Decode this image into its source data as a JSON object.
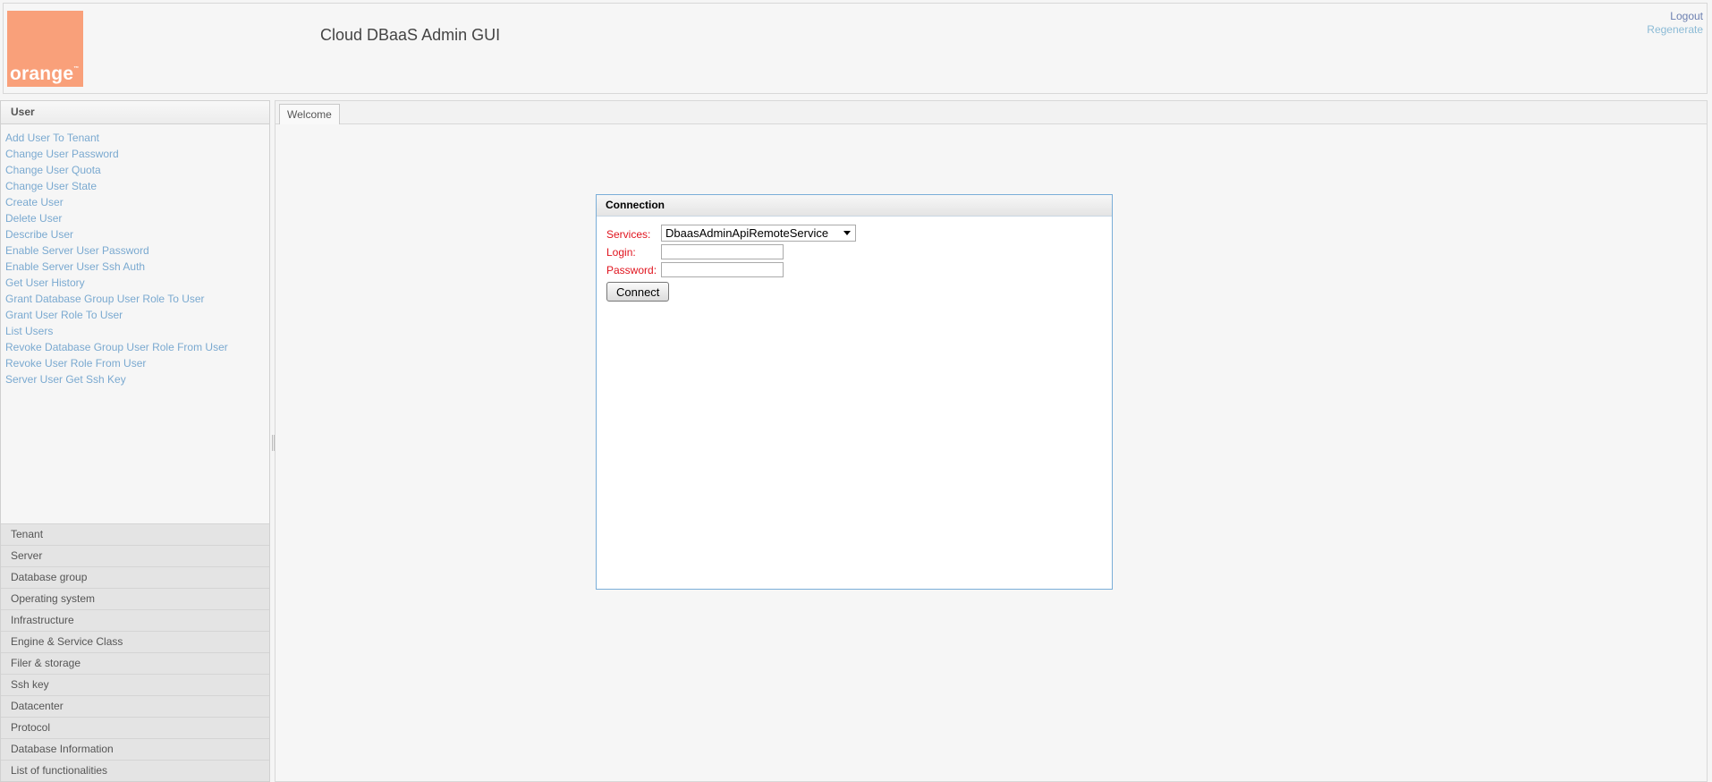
{
  "header": {
    "logo_text": "orange",
    "title": "Cloud DBaaS Admin GUI",
    "logout": "Logout",
    "regenerate": "Regenerate"
  },
  "left_panel": {
    "active_section": "User",
    "actions": [
      "Add User To Tenant",
      "Change User Password",
      "Change User Quota",
      "Change User State",
      "Create User",
      "Delete User",
      "Describe User",
      "Enable Server User Password",
      "Enable Server User Ssh Auth",
      "Get User History",
      "Grant Database Group User Role To User",
      "Grant User Role To User",
      "List Users",
      "Revoke Database Group User Role From User",
      "Revoke User Role From User",
      "Server User Get Ssh Key"
    ],
    "sections": [
      "Tenant",
      "Server",
      "Database group",
      "Operating system",
      "Infrastructure",
      "Engine & Service Class",
      "Filer & storage",
      "Ssh key",
      "Datacenter",
      "Protocol",
      "Database Information",
      "List of functionalities"
    ]
  },
  "main": {
    "tab": "Welcome"
  },
  "dialog": {
    "title": "Connection",
    "services_label": "Services:",
    "services_value": "DbaasAdminApiRemoteService",
    "login_label": "Login:",
    "login_value": "",
    "password_label": "Password:",
    "password_value": "",
    "connect_label": "Connect"
  },
  "colors": {
    "brand": "#f9a07a",
    "link": "#7aa9d0",
    "required_label": "#e0141e",
    "dialog_border": "#7aaed8"
  }
}
